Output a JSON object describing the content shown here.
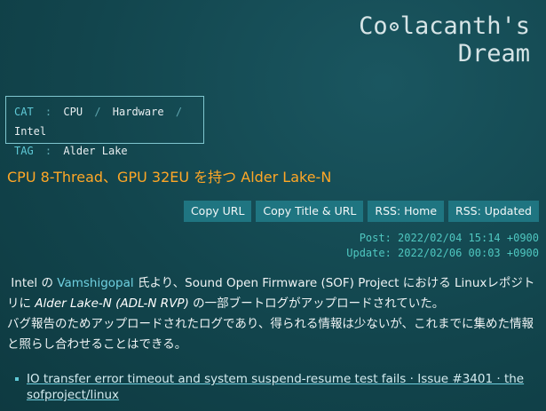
{
  "site": {
    "title_line1_pre": "Co",
    "title_line1_post": "lacanth's",
    "title_line2": "Dream"
  },
  "meta": {
    "cat_label": "CAT",
    "tag_label": "TAG",
    "colon": ":",
    "slash": "/",
    "categories": [
      "CPU",
      "Hardware",
      "Intel"
    ],
    "tag": "Alder Lake"
  },
  "post": {
    "title": "CPU 8-Thread、GPU 32EU を持つ Alder Lake-N",
    "buttons": [
      "Copy URL",
      "Copy Title & URL",
      "RSS: Home",
      "RSS: Updated"
    ],
    "posted": "Post: 2022/02/04 15:14 +0900",
    "updated": "Update: 2022/02/06 00:03 +0900",
    "body": {
      "p1_a": "Intel の ",
      "p1_link": "Vamshigopal",
      "p1_b": " 氏より、Sound Open Firmware (SOF) Project における Linuxレポジトリに ",
      "p1_em": "Alder Lake-N (ADL-N RVP)",
      "p1_c": " の一部ブートログがアップロードされていた。",
      "p2": "バグ報告のためアップロードされたログであり、得られる情報は少ないが、これまでに集めた情報と照らし合わせることはできる。"
    },
    "references": [
      "IO transfer error timeout and system suspend-resume test fails · Issue #3401 · the sofproject/linux"
    ]
  },
  "colors": {
    "background": "#12454d",
    "accent_title": "#ffa726",
    "button": "#1f7581",
    "key": "#5fc9d6",
    "date": "#4fc7c0"
  }
}
